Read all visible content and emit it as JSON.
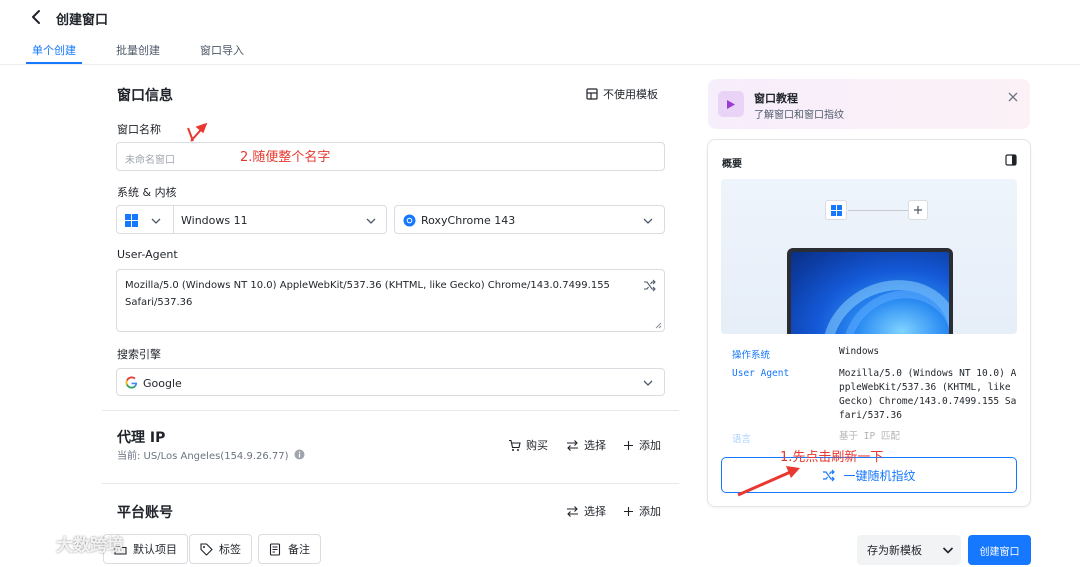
{
  "header": {
    "title": "创建窗口",
    "tabs": [
      {
        "label": "单个创建",
        "active": true
      },
      {
        "label": "批量创建",
        "active": false
      },
      {
        "label": "窗口导入",
        "active": false
      }
    ]
  },
  "window_info": {
    "section_title": "窗口信息",
    "no_template_label": "不使用模板",
    "name_label": "窗口名称",
    "name_placeholder": "未命名窗口",
    "name_value": "",
    "os_kernel_label": "系统 & 内核",
    "os_version": "Windows 11",
    "browser": "RoxyChrome 143",
    "ua_label": "User-Agent",
    "ua_value": "Mozilla/5.0 (Windows NT 10.0) AppleWebKit/537.36 (KHTML, like Gecko) Chrome/143.0.7499.155\nSafari/537.36",
    "search_label": "搜索引擎",
    "search_value": "Google"
  },
  "proxy": {
    "title": "代理 IP",
    "current": "当前: US/Los Angeles(154.9.26.77)",
    "buy": "购买",
    "select": "选择",
    "add": "添加"
  },
  "platform": {
    "title": "平台账号",
    "select": "选择",
    "add": "添加"
  },
  "tutorial": {
    "title": "窗口教程",
    "subtitle": "了解窗口和窗口指纹"
  },
  "overview": {
    "title": "概要",
    "rows": [
      {
        "key": "操作系统",
        "value": "Windows"
      },
      {
        "key": "User Agent",
        "value": "Mozilla/5.0 (Windows NT 10.0) AppleWebKit/537.36 (KHTML, like Gecko) Chrome/143.0.7499.155 Safari/537.36"
      },
      {
        "key": "语言",
        "value": "基于 IP 匹配"
      }
    ],
    "random_button": "一键随机指纹"
  },
  "footer": {
    "default_items": "默认项目",
    "tags": "标签",
    "notes": "备注",
    "save_template": "存为新模板",
    "create": "创建窗口"
  },
  "annotations": {
    "step1": "1.先点击刷新一下",
    "step2": "2.随便整个名字",
    "color": "#e8382f"
  },
  "watermark": {
    "text": "大数跨境"
  },
  "colors": {
    "primary": "#1677ff",
    "text": "#1f2329",
    "muted": "#4e5969"
  }
}
